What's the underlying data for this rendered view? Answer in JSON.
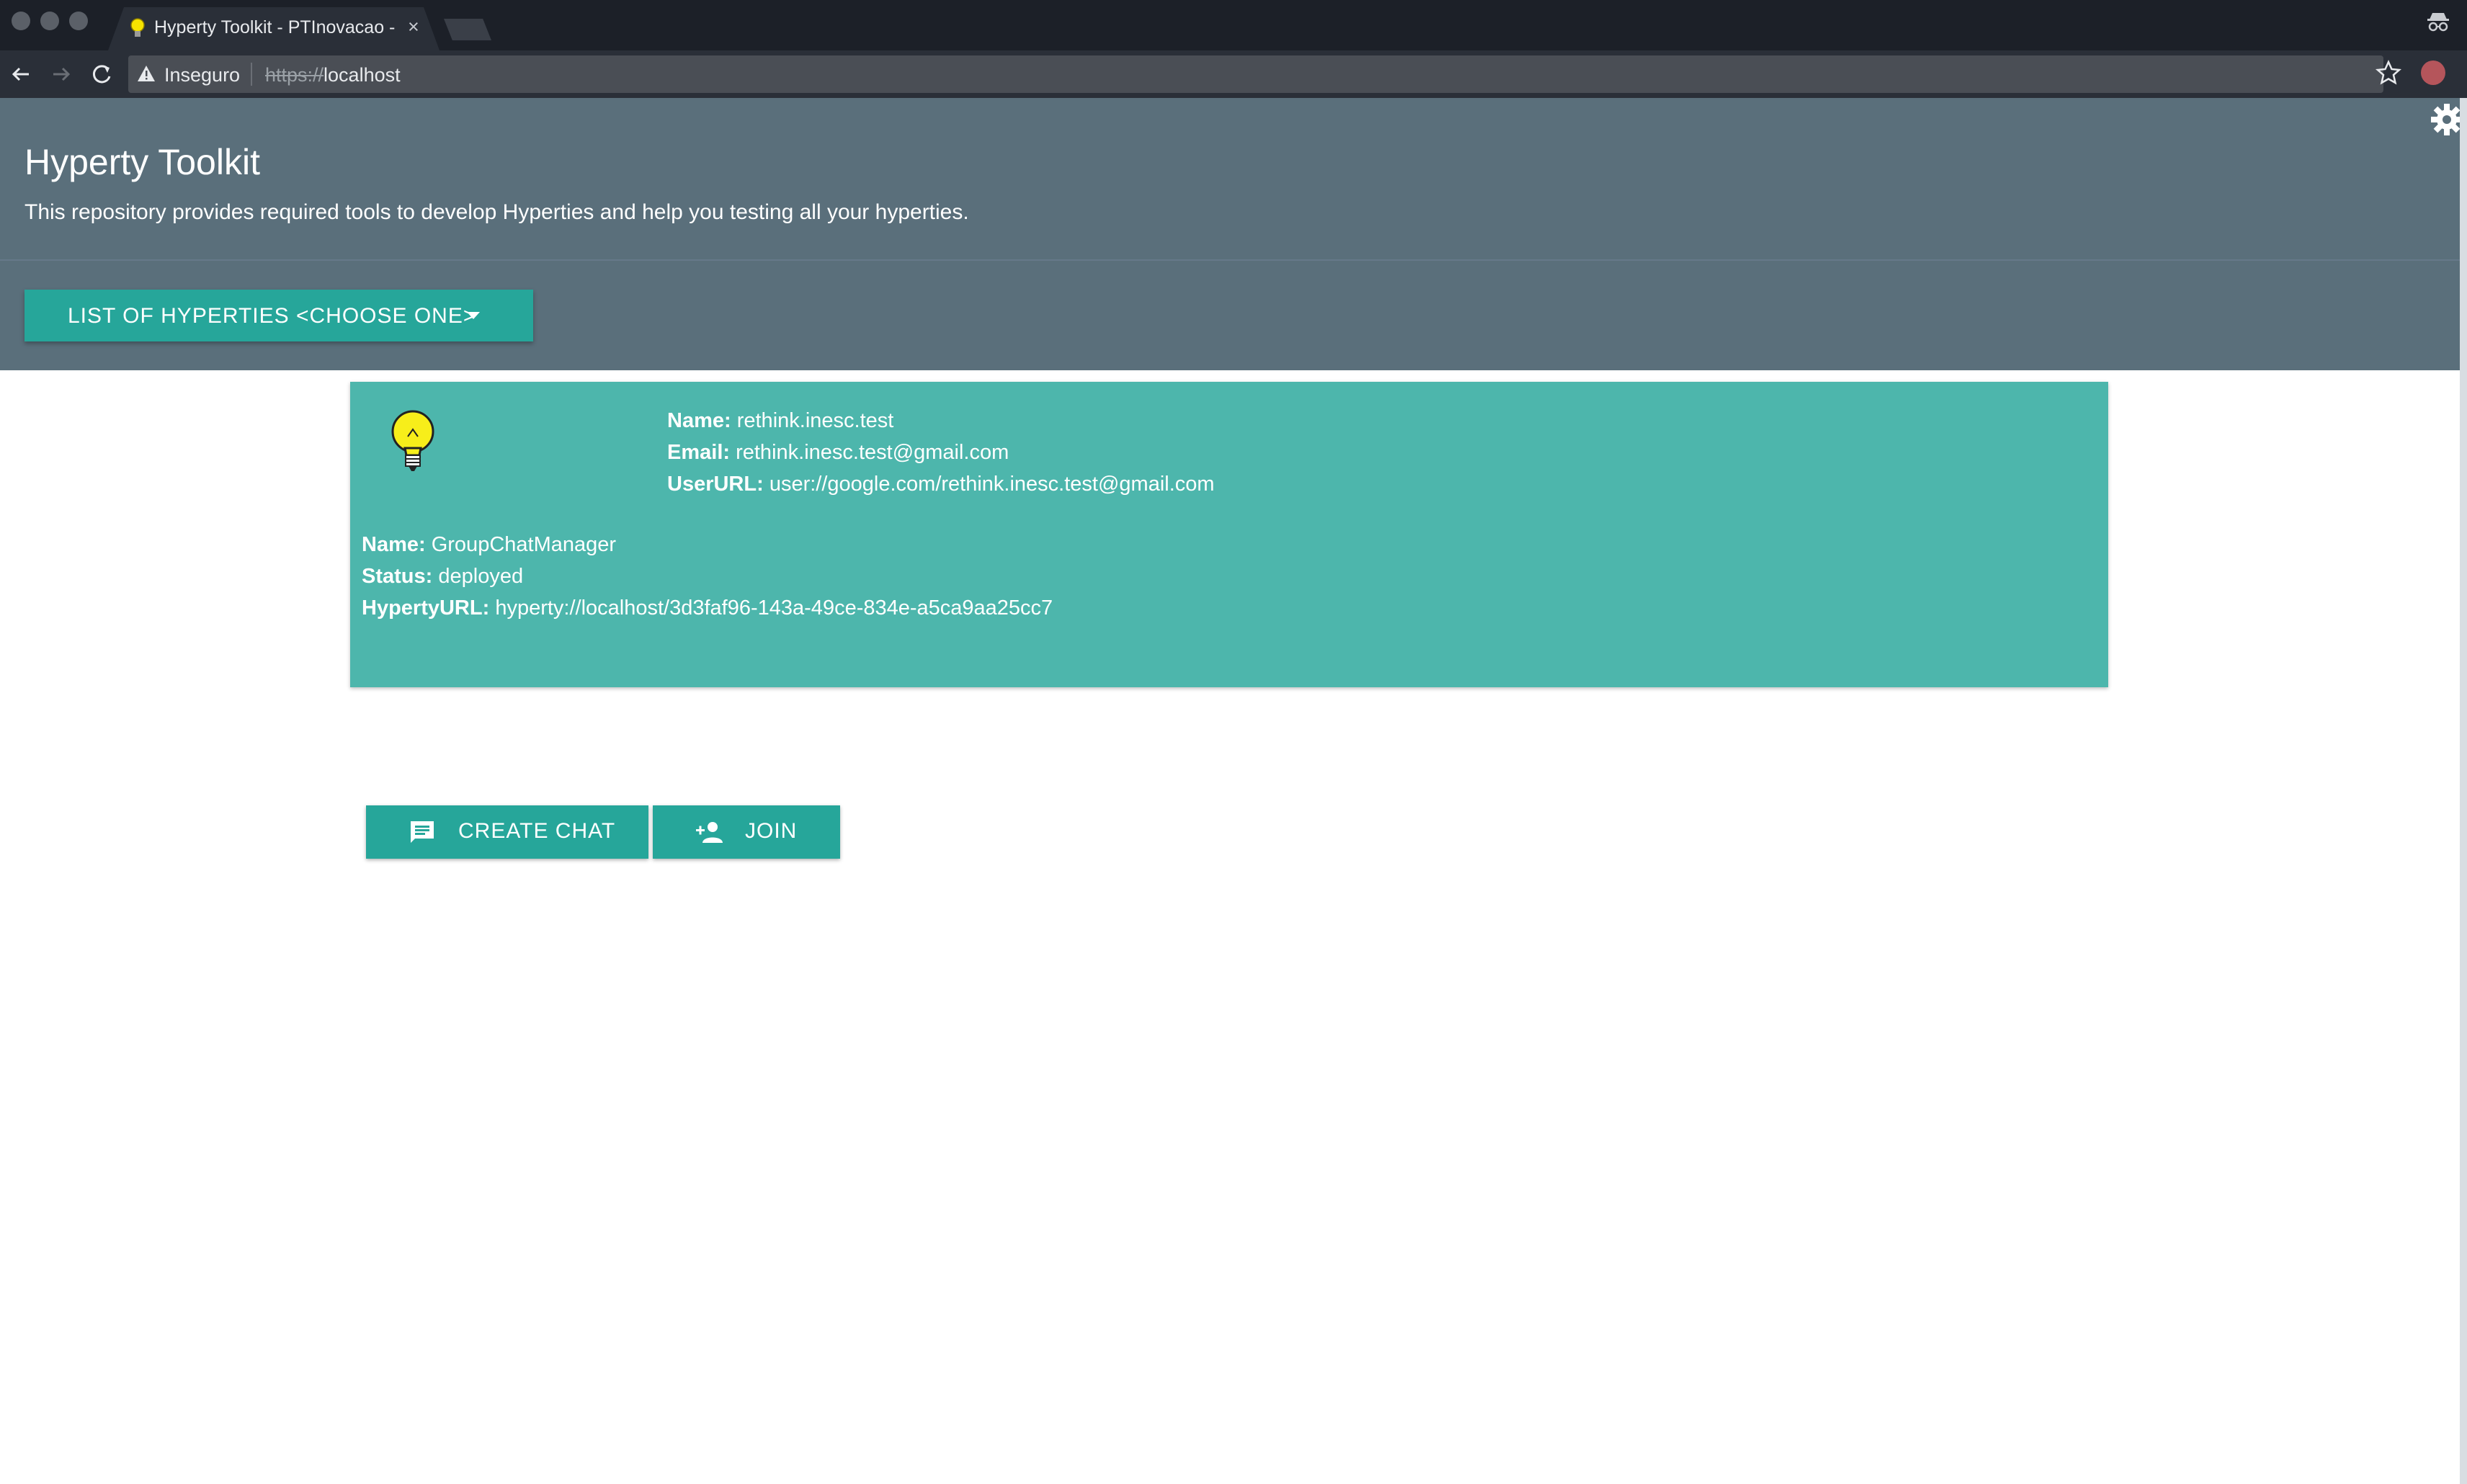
{
  "browser": {
    "tab_title": "Hyperty Toolkit - PTInovacao -",
    "tab_close": "×",
    "security_label": "Inseguro",
    "url_scheme": "https://",
    "url_host": "localhost"
  },
  "header": {
    "title": "Hyperty Toolkit",
    "description": "This repository provides required tools to develop Hyperties and help you testing all your hyperties.",
    "dropdown_label": "LIST OF HYPERTIES <CHOOSE ONE>"
  },
  "user": {
    "name_label": "Name:",
    "name": "rethink.inesc.test",
    "email_label": "Email:",
    "email": "rethink.inesc.test@gmail.com",
    "userurl_label": "UserURL:",
    "userurl": "user://google.com/rethink.inesc.test@gmail.com"
  },
  "hyperty": {
    "name_label": "Name:",
    "name": "GroupChatManager",
    "status_label": "Status:",
    "status": "deployed",
    "url_label": "HypertyURL:",
    "url": "hyperty://localhost/3d3faf96-143a-49ce-834e-a5ca9aa25cc7"
  },
  "actions": {
    "create_chat_label": "CREATE CHAT",
    "join_label": "JOIN"
  },
  "colors": {
    "header_bg": "#5a6f7b",
    "card_bg": "#4db6ac",
    "button_bg": "#26a69a",
    "chrome_bg": "#1c2028"
  },
  "icons": [
    "bulb-icon",
    "back-arrow-icon",
    "forward-arrow-icon",
    "reload-icon",
    "warning-icon",
    "star-icon",
    "gear-icon",
    "chat-icon",
    "group-add-icon",
    "incognito-icon",
    "caret-down-icon"
  ]
}
